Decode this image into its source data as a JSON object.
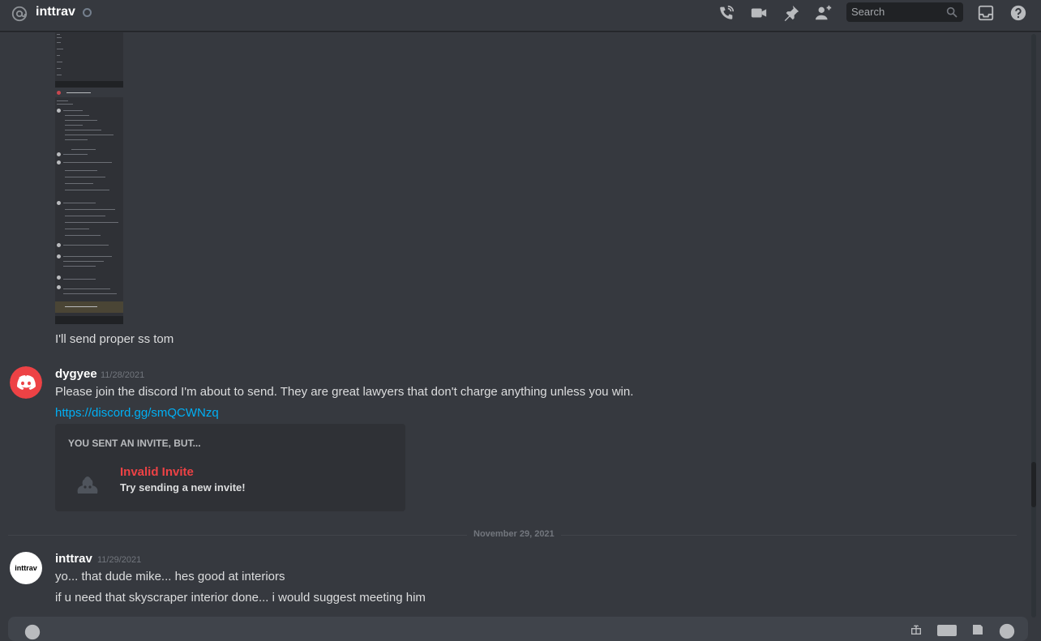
{
  "header": {
    "channel_name": "inttrav",
    "search_placeholder": "Search"
  },
  "messages": {
    "first": {
      "text": "I'll send proper ss tom"
    },
    "second": {
      "author": "dygyee",
      "timestamp": "11/28/2021",
      "text": "Please join the discord I'm about to send. They are great lawyers that don't charge anything unless you win.",
      "link": "https://discord.gg/smQCWNzq",
      "invite": {
        "heading": "YOU SENT AN INVITE, BUT...",
        "title": "Invalid Invite",
        "subtitle": "Try sending a new invite!"
      }
    },
    "date_divider": "November 29, 2021",
    "third": {
      "author": "inttrav",
      "timestamp": "11/29/2021",
      "avatar_text": "inttrav",
      "lines": [
        "yo... that dude mike... hes good at interiors",
        "if u need that skyscraper interior done... i would suggest meeting him"
      ]
    }
  },
  "colors": {
    "background": "#36393f",
    "link": "#00aff4",
    "invalid": "#ed4245",
    "discord_red_avatar": "#ed4245"
  },
  "icons": [
    "at-icon",
    "phone-call-icon",
    "video-icon",
    "pin-icon",
    "add-member-icon",
    "search-icon",
    "inbox-icon",
    "help-icon",
    "discord-logo-icon",
    "gift-icon",
    "gif-icon",
    "sticker-icon",
    "emoji-icon",
    "add-attachment-icon"
  ]
}
